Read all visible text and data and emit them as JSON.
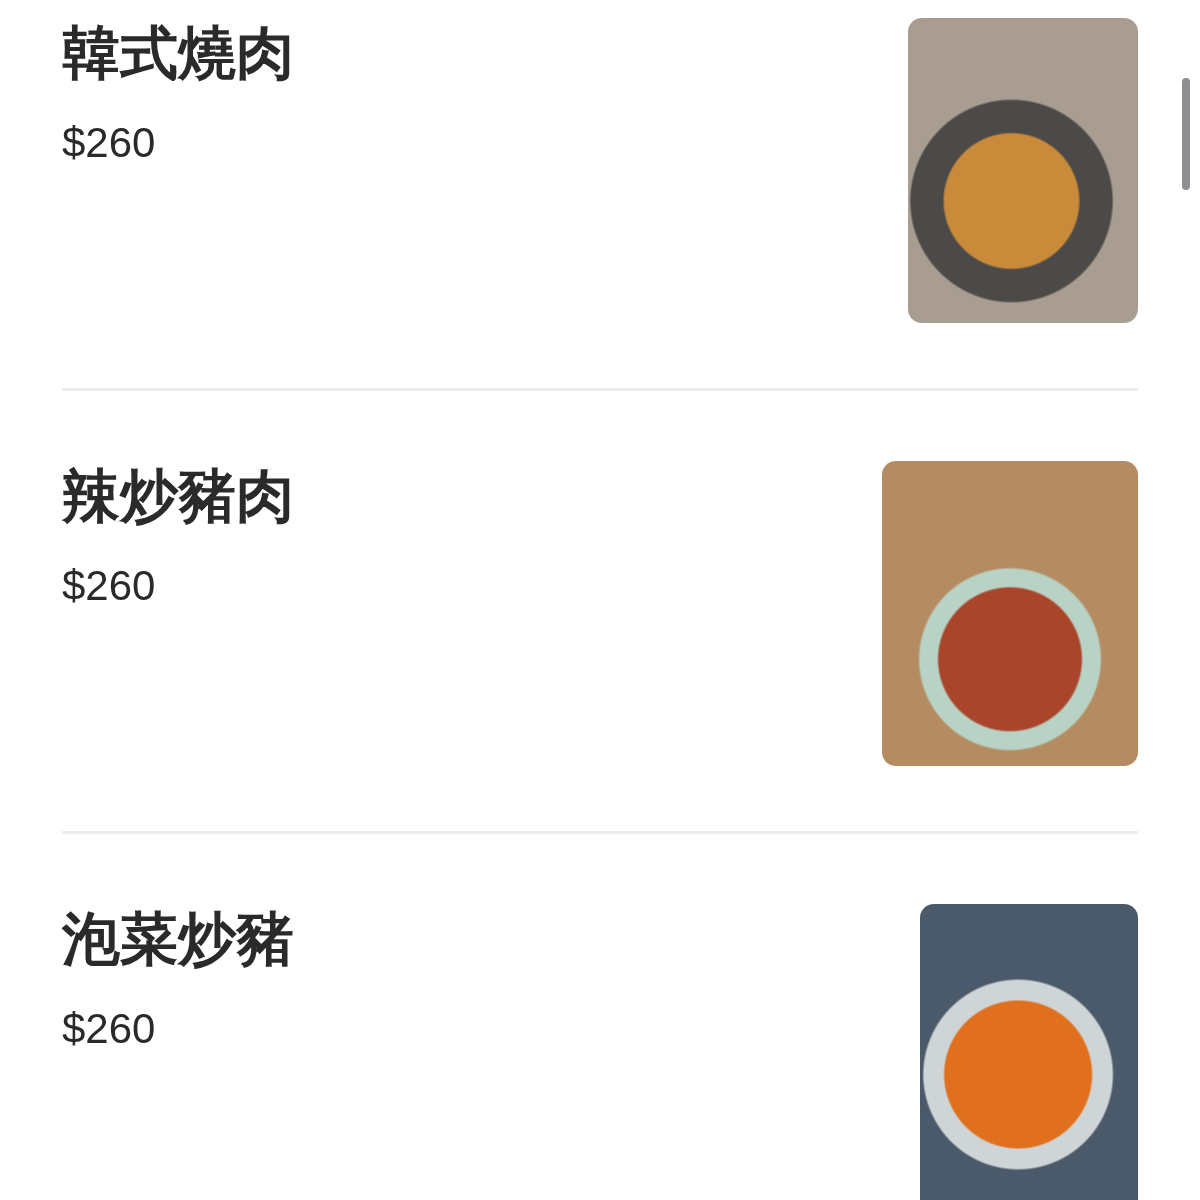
{
  "menu_items": [
    {
      "name": "韓式燒肉",
      "price": "$260"
    },
    {
      "name": "辣炒豬肉",
      "price": "$260"
    },
    {
      "name": "泡菜炒豬",
      "price": "$260"
    }
  ]
}
